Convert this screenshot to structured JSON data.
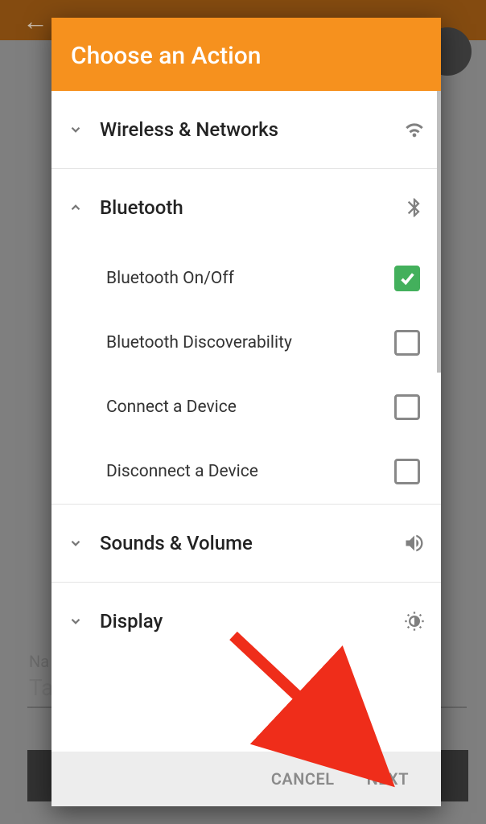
{
  "bg": {
    "label_name": "Na",
    "field_text": "Ta"
  },
  "dialog": {
    "title": "Choose an Action",
    "sections": [
      {
        "title": "Wireless & Networks",
        "expanded": false,
        "icon": "wifi"
      },
      {
        "title": "Bluetooth",
        "expanded": true,
        "icon": "bluetooth",
        "items": [
          {
            "label": "Bluetooth On/Off",
            "checked": true
          },
          {
            "label": "Bluetooth Discoverability",
            "checked": false
          },
          {
            "label": "Connect a Device",
            "checked": false
          },
          {
            "label": "Disconnect a Device",
            "checked": false
          }
        ]
      },
      {
        "title": "Sounds & Volume",
        "expanded": false,
        "icon": "volume"
      },
      {
        "title": "Display",
        "expanded": false,
        "icon": "brightness"
      }
    ],
    "buttons": {
      "cancel": "CANCEL",
      "next": "NEXT"
    }
  }
}
